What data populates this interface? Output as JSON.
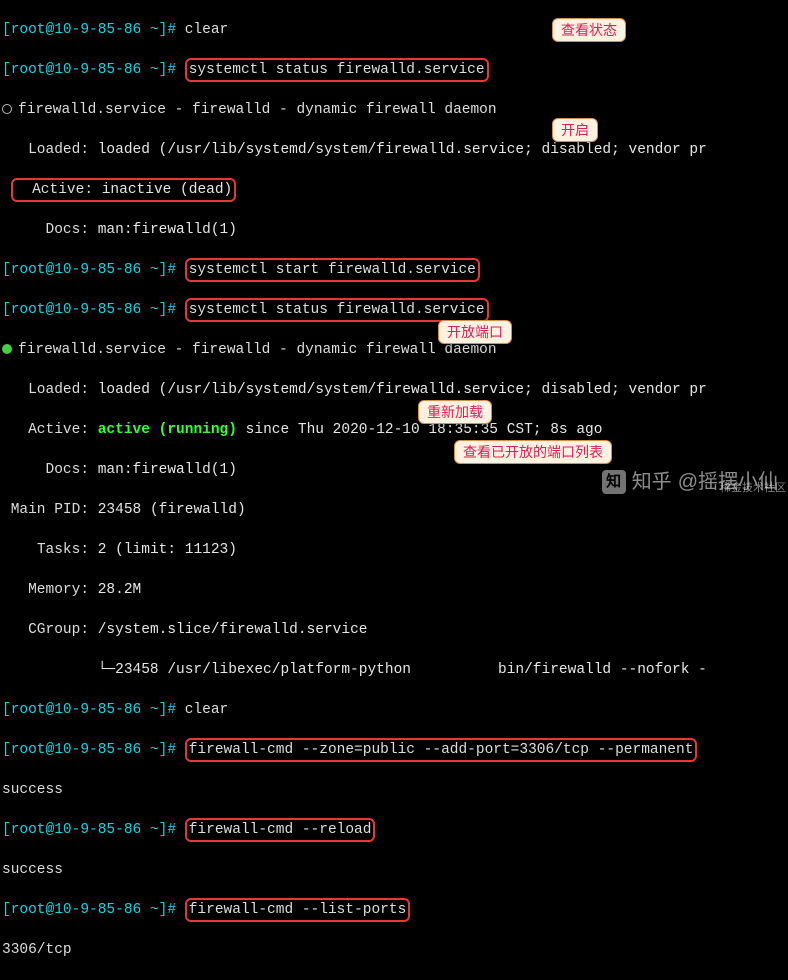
{
  "prompt": {
    "host": "[root@10-9-85-86 ~]#"
  },
  "cmd": {
    "clear": "clear",
    "status": "systemctl status firewalld.service",
    "start": "systemctl start firewalld.service",
    "addport": "firewall-cmd --zone=public --add-port=3306/tcp --permanent",
    "reload": "firewall-cmd --reload",
    "listports": "firewall-cmd --list-ports"
  },
  "svc1": {
    "title": "firewalld.service - firewalld - dynamic firewall daemon",
    "loaded": "loaded (/usr/lib/systemd/system/firewalld.service; disabled; vendor pr",
    "active": "inactive (dead)",
    "docs": "man:firewalld(1)"
  },
  "svc2": {
    "title": "firewalld.service - firewalld - dynamic firewall daemon",
    "loaded": "loaded (/usr/lib/systemd/system/firewalld.service; disabled; vendor pr",
    "active_state": "active (running)",
    "active_since": "since Thu 2020-12-10 18:35:35 CST; 8s ago",
    "docs": "man:firewalld(1)",
    "mainpid": "23458 (firewalld)",
    "tasks": "2 (limit: 11123)",
    "memory": "28.2M",
    "cgroup": "/system.slice/firewalld.service",
    "cgroup_child": "└─23458 /usr/libexec/platform-python",
    "cgroup_child_tail": "bin/firewalld --nofork -"
  },
  "result": {
    "success1": "success",
    "success2": "success",
    "port_list": "3306/tcp"
  },
  "ann": {
    "status": "查看状态",
    "start": "开启",
    "openport": "开放端口",
    "reload": "重新加载",
    "listports": "查看已开放的端口列表"
  },
  "labels": {
    "Loaded": "Loaded:",
    "Active": "Active:",
    "Docs": "Docs:",
    "MainPID": "Main PID:",
    "Tasks": "Tasks:",
    "Memory": "Memory:",
    "CGroup": "CGroup:"
  },
  "watermark": {
    "site": "知乎",
    "author": "@摇摆小仙",
    "corner": "稀金技术社区"
  }
}
